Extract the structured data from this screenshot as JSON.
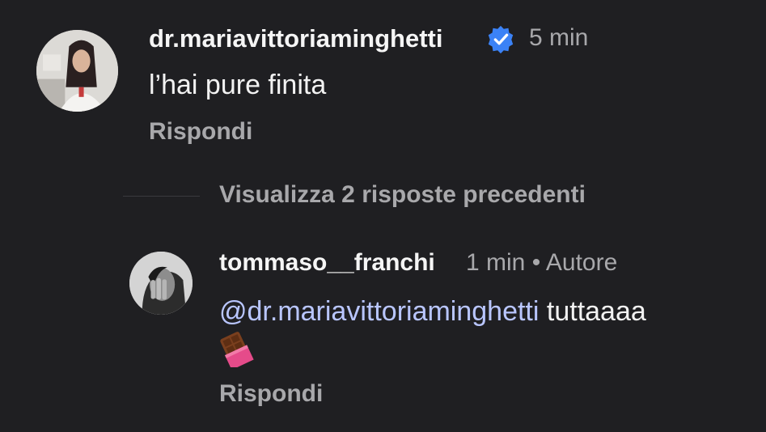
{
  "comment": {
    "username": "dr.mariavittoriaminghetti",
    "timestamp": "5 min",
    "text": "l’hai pure finita",
    "reply_label": "Rispondi"
  },
  "view_previous_replies": "Visualizza 2 risposte precedenti",
  "reply": {
    "username": "tommaso__franchi",
    "timestamp": "1 min",
    "separator": "•",
    "author_label": "Autore",
    "mention": "@dr.mariavittoriaminghetti",
    "text": "tuttaaaa",
    "reply_label": "Rispondi"
  },
  "colors": {
    "background": "#1f1f22",
    "primary_text": "#f2f2f2",
    "secondary_text": "#a8a8ab",
    "mention": "#b9c6ff",
    "verified_badge": "#3b82f6"
  },
  "icons": {
    "verified": "verified-badge-icon",
    "emoji": "chocolate-bar-emoji"
  }
}
